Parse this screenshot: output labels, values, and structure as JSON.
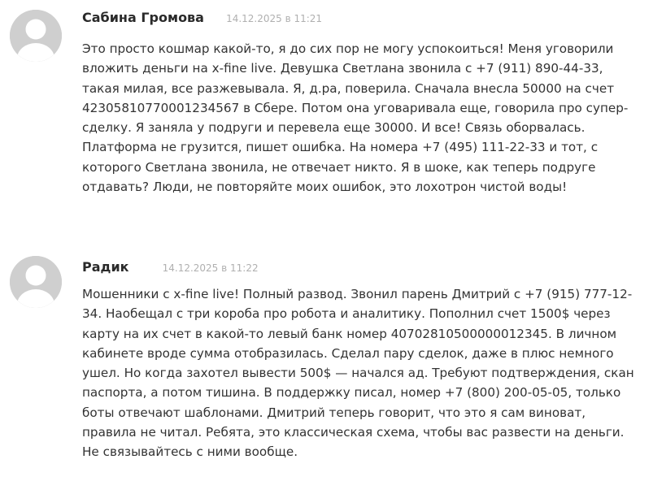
{
  "comments": [
    {
      "author": "Сабина Громова",
      "date": "14.12.2025 в 11:21",
      "avatar_icon": "default-user-avatar-icon",
      "text": "Это просто кошмар какой-то, я до сих пор не могу успокоиться! Меня уговорили вложить деньги на x-fine live. Девушка Светлана звонила с +7 (911) 890-44-33, такая милая, все разжевывала. Я, д.ра, поверила. Сначала внесла 50000 на счет 42305810770001234567 в Сбере. Потом она уговаривала еще, говорила про супер-сделку. Я заняла у подруги и перевела еще 30000. И все! Связь оборвалась. Платформа не грузится, пишет ошибка. На номера +7 (495) 111-22-33 и тот, с которого Светлана звонила, не отвечает никто. Я в шоке, как теперь подруге отдавать? Люди, не повторяйте моих ошибок, это лохотрон чистой воды!"
    },
    {
      "author": "Радик",
      "date": "14.12.2025 в 11:22",
      "avatar_icon": "default-user-avatar-icon",
      "text": "Мошенники с x-fine live! Полный развод. Звонил парень Дмитрий с +7 (915) 777-12-34. Наобещал с три короба про робота и аналитику. Пополнил счет 1500$ через карту на их счет в какой-то левый банк номер 40702810500000012345. В личном кабинете вроде сумма отобразилась. Сделал пару сделок, даже в плюс немного ушел. Но когда захотел вывести 500$ — начался ад. Требуют подтверждения, скан паспорта, а потом тишина. В поддержку писал, номер +7 (800) 200-05-05, только боты отвечают шаблонами. Дмитрий теперь говорит, что это я сам виноват, правила не читал. Ребята, это классическая схема, чтобы вас развести на деньги. Не связывайтесь с ними вообще."
    }
  ],
  "colors": {
    "avatar_bg": "#cfcfcf",
    "avatar_fg": "#ffffff",
    "author": "#2a2a2a",
    "date": "#b0b0b0",
    "body": "#333333"
  }
}
